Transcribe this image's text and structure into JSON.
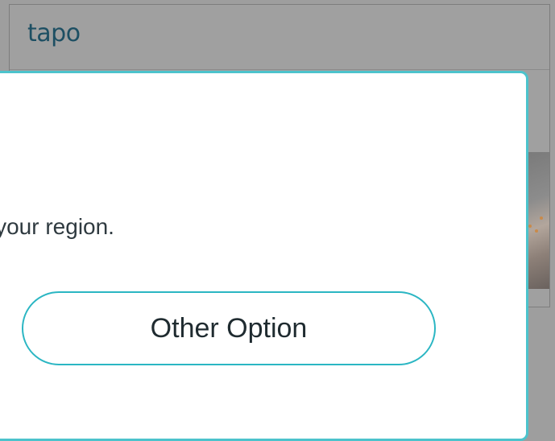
{
  "background_page": {
    "logo_text": "tapo"
  },
  "dialog": {
    "message_visible": "r your region.",
    "other_option_label": "Other Option"
  },
  "colors": {
    "accent": "#2bb6c3",
    "modal_border": "#4cc3cc",
    "logo": "#1d4f63",
    "text": "#2f3a40"
  }
}
